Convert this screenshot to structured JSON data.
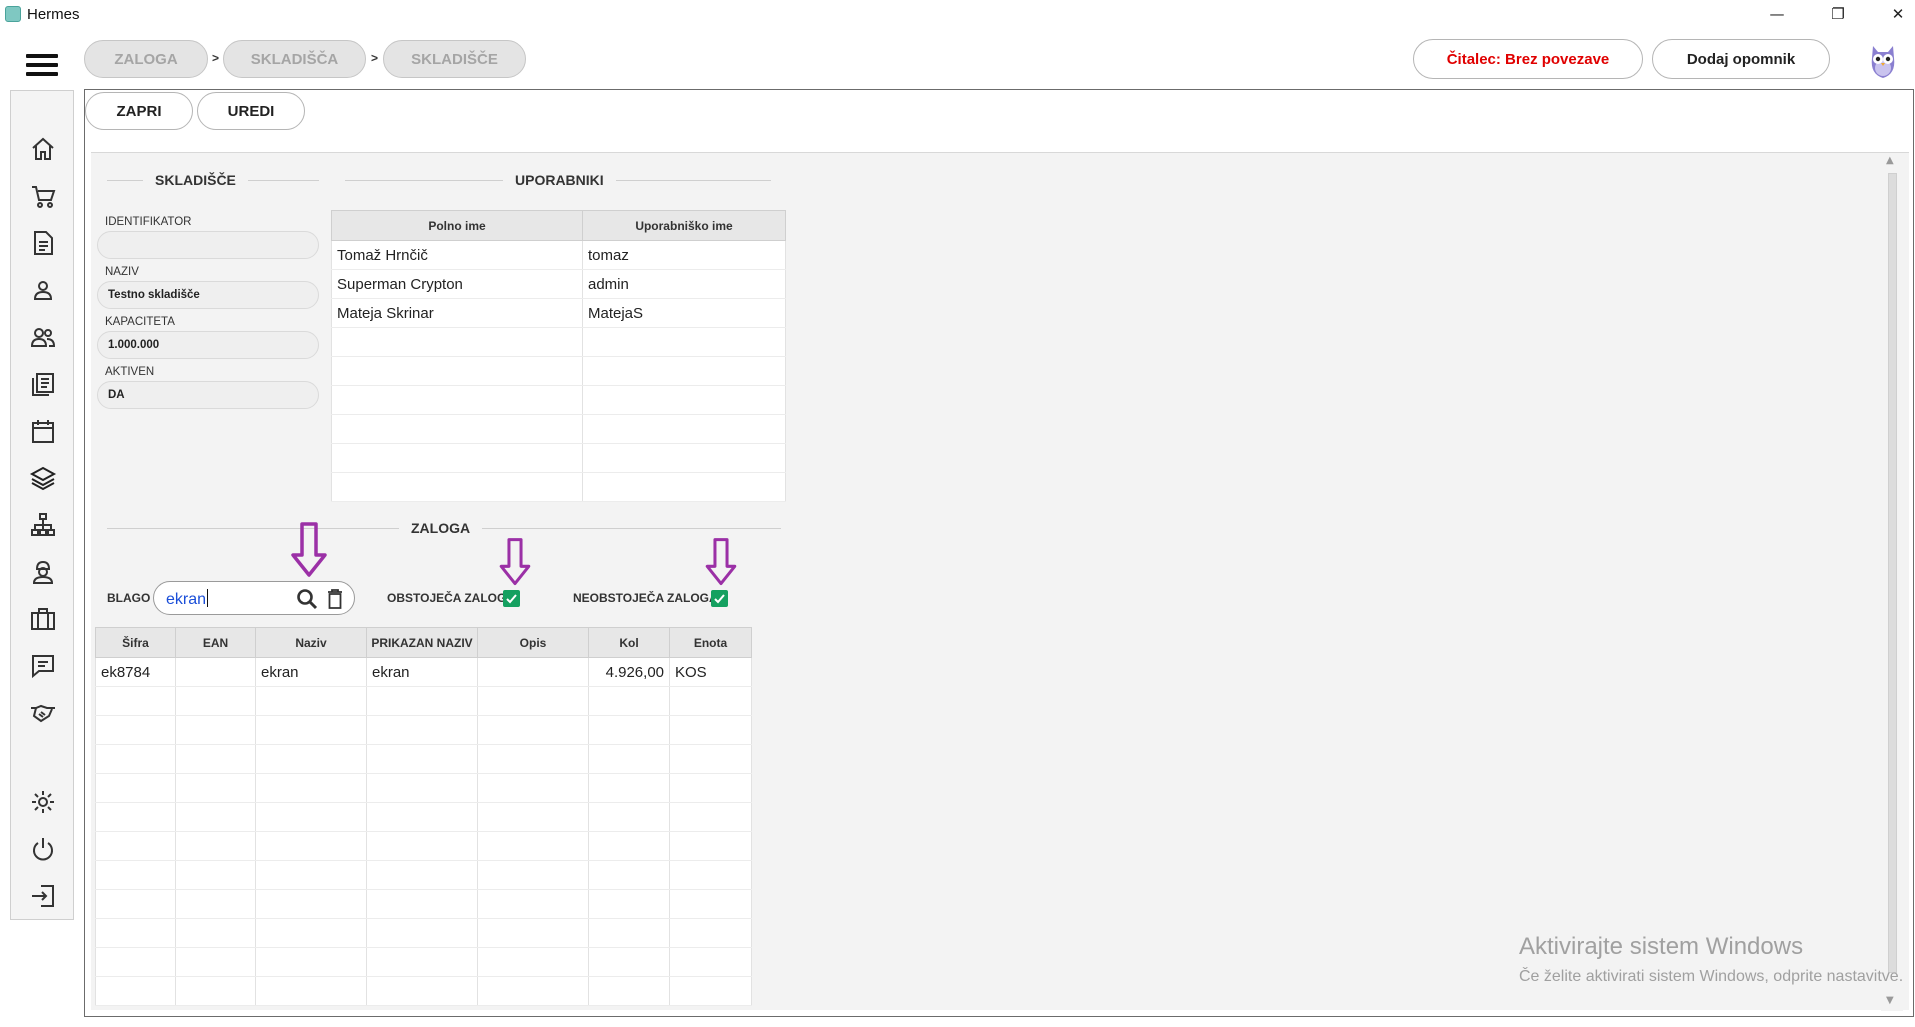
{
  "window": {
    "title": "Hermes",
    "minimize": "—",
    "maximize": "❐",
    "close": "✕"
  },
  "breadcrumb": [
    "ZALOGA",
    "SKLADIŠČA",
    "SKLADIŠČE"
  ],
  "breadcrumb_sep": ">",
  "header": {
    "reader_status": "Čitalec: Brez povezave",
    "add_reminder": "Dodaj opomnik"
  },
  "actions": {
    "close": "ZAPRI",
    "edit": "UREDI"
  },
  "sidebar_icons": [
    "home-icon",
    "cart-icon",
    "document-icon",
    "person-icon",
    "people-icon",
    "list-icon",
    "calendar-icon",
    "layers-icon",
    "network-icon",
    "worker-icon",
    "briefcase-icon",
    "chat-icon",
    "handshake-icon",
    "gear-icon",
    "power-icon",
    "logout-icon"
  ],
  "warehouse": {
    "title": "SKLADIŠČE",
    "fields": [
      {
        "label": "IDENTIFIKATOR",
        "value": ""
      },
      {
        "label": "NAZIV",
        "value": "Testno skladišče"
      },
      {
        "label": "KAPACITETA",
        "value": "1.000.000"
      },
      {
        "label": "AKTIVEN",
        "value": "DA"
      }
    ]
  },
  "users": {
    "title": "UPORABNIKI",
    "columns": [
      "Polno ime",
      "Uporabniško ime"
    ],
    "rows": [
      [
        "Tomaž Hrnčič",
        "tomaz"
      ],
      [
        "Superman Crypton",
        "admin"
      ],
      [
        "Mateja Skrinar",
        "MatejaS"
      ]
    ]
  },
  "stock": {
    "title": "ZALOGA",
    "search_label": "BLAGO",
    "search_value": "ekran",
    "existing_label": "OBSTOJEČA ZALOGA",
    "existing_checked": true,
    "nonexisting_label": "NEOBSTOJEČA ZALOGA",
    "nonexisting_checked": true,
    "columns": [
      "Šifra",
      "EAN",
      "Naziv",
      "PRIKAZAN NAZIV",
      "Opis",
      "Kol",
      "Enota"
    ],
    "rows": [
      [
        "ek8784",
        "",
        "ekran",
        "ekran",
        "",
        "4.926,00",
        "KOS"
      ]
    ]
  },
  "watermark": {
    "line1": "Aktivirajte sistem Windows",
    "line2": "Če želite aktivirati sistem Windows, odprite nastavitve."
  },
  "colors": {
    "accent": "#79c6c0",
    "alert": "#e00000",
    "arrow": "#9b30a6",
    "check": "#15a060"
  }
}
